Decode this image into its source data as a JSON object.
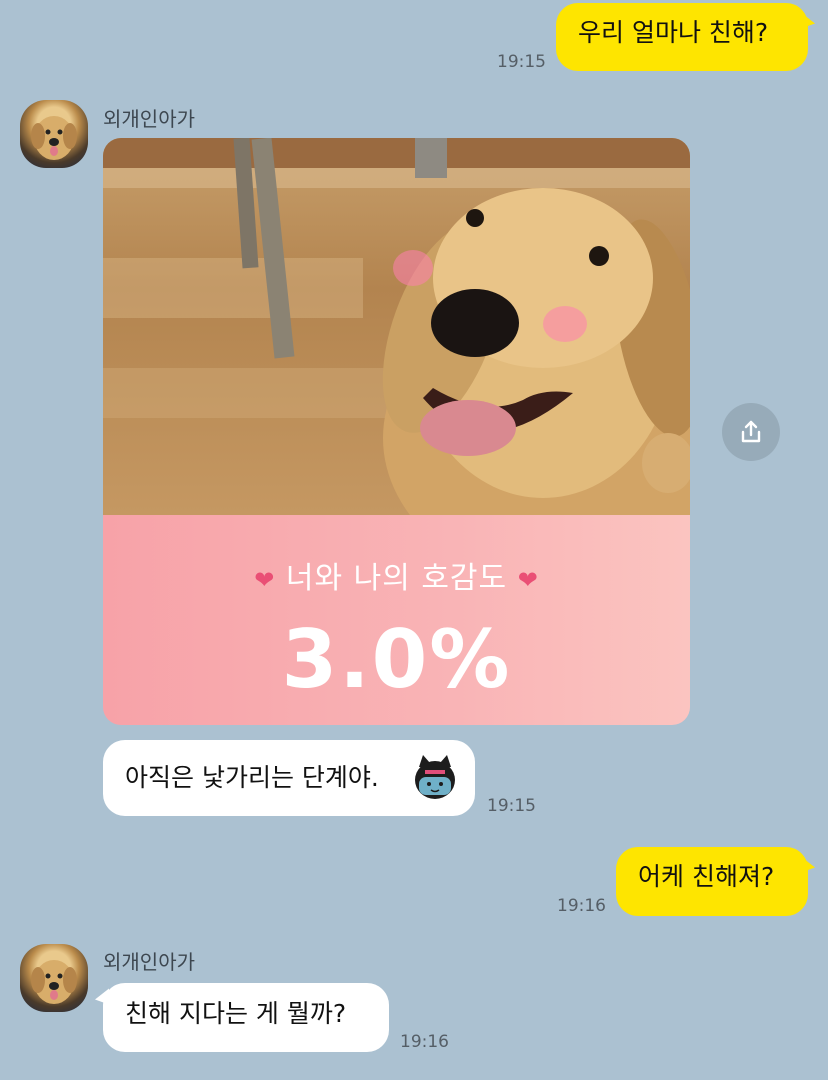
{
  "messages": {
    "m1": {
      "text": "우리 얼마나 친해?",
      "time": "19:15"
    },
    "m2": {
      "sender": "외개인아가",
      "card": {
        "title": "너와 나의 호감도",
        "value": "3.0%"
      }
    },
    "m3": {
      "text": "아직은 낯가리는 단계야.",
      "time": "19:15",
      "emoji": "kakao-character-emoji"
    },
    "m4": {
      "text": "어케 친해져?",
      "time": "19:16"
    },
    "m5": {
      "sender": "외개인아가",
      "text": "친해 지다는 게 뭘까?",
      "time": "19:16"
    }
  },
  "icons": {
    "share": "share-icon",
    "avatar": "dog-avatar"
  },
  "colors": {
    "background": "#abc1d1",
    "my_bubble": "#fee500",
    "other_bubble": "#ffffff",
    "card_pink": "#f9b4b6",
    "heart": "#ea4f75"
  }
}
